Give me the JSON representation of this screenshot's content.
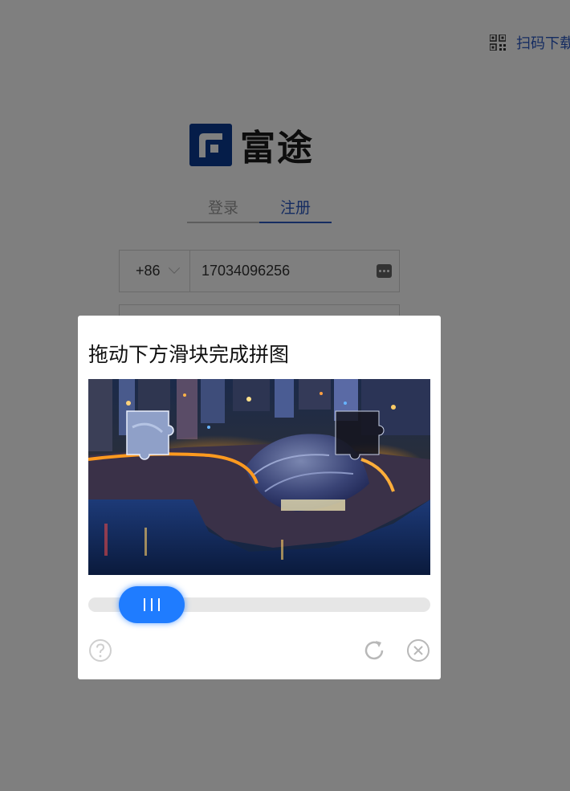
{
  "header": {
    "download_text": "扫码下载",
    "qr_icon": "qr-code-icon"
  },
  "brand": {
    "logo_text": "富途",
    "logo_color": "#0a3a93"
  },
  "auth_tabs": [
    {
      "label": "登录",
      "active": false
    },
    {
      "label": "注册",
      "active": true
    }
  ],
  "form": {
    "country_code": "+86",
    "phone_value": "17034096256",
    "keyboard_icon": "password-keyboard-icon"
  },
  "captcha": {
    "title": "拖动下方滑块完成拼图",
    "slider_progress": 0.11,
    "icons": {
      "help": "help-icon",
      "refresh": "refresh-icon",
      "close": "close-icon"
    },
    "accent_color": "#1f7cff"
  }
}
